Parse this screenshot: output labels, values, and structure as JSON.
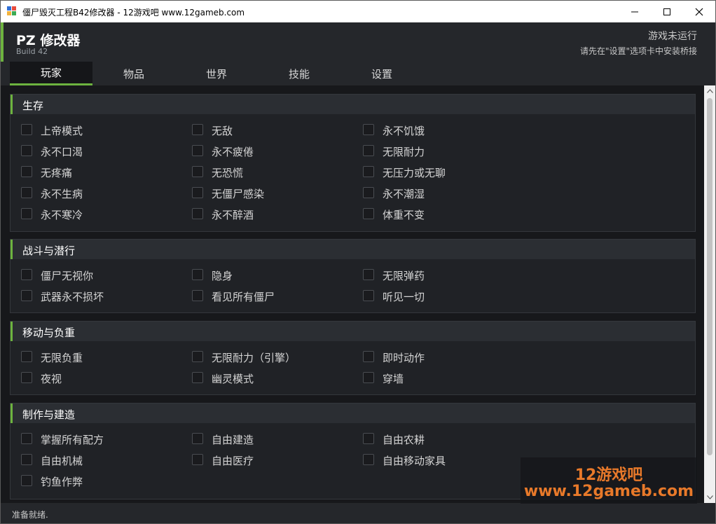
{
  "window": {
    "title": "僵尸毁灭工程B42修改器 - 12游戏吧 www.12gameb.com",
    "app_icon": "app-window-icon",
    "controls": [
      "minimize-icon",
      "maximize-icon",
      "close-icon"
    ]
  },
  "header": {
    "title": "PZ 修改器",
    "build": "Build 42",
    "status_main": "游戏未运行",
    "status_sub": "请先在\"设置\"选项卡中安装桥接"
  },
  "colors": {
    "accent": "#6db33f",
    "background": "#202226",
    "watermark": "#e8792a"
  },
  "tabs": [
    {
      "label": "玩家",
      "active": true
    },
    {
      "label": "物品",
      "active": false
    },
    {
      "label": "世界",
      "active": false
    },
    {
      "label": "技能",
      "active": false
    },
    {
      "label": "设置",
      "active": false
    }
  ],
  "sections": [
    {
      "title": "生存",
      "options": [
        {
          "label": "上帝模式",
          "checked": false
        },
        {
          "label": "无敌",
          "checked": false
        },
        {
          "label": "永不饥饿",
          "checked": false
        },
        {
          "label": "永不口渴",
          "checked": false
        },
        {
          "label": "永不疲倦",
          "checked": false
        },
        {
          "label": "无限耐力",
          "checked": false
        },
        {
          "label": "无疼痛",
          "checked": false
        },
        {
          "label": "无恐慌",
          "checked": false
        },
        {
          "label": "无压力或无聊",
          "checked": false
        },
        {
          "label": "永不生病",
          "checked": false
        },
        {
          "label": "无僵尸感染",
          "checked": false
        },
        {
          "label": "永不潮湿",
          "checked": false
        },
        {
          "label": "永不寒冷",
          "checked": false
        },
        {
          "label": "永不醉酒",
          "checked": false
        },
        {
          "label": "体重不变",
          "checked": false
        }
      ]
    },
    {
      "title": "战斗与潜行",
      "options": [
        {
          "label": "僵尸无视你",
          "checked": false
        },
        {
          "label": "隐身",
          "checked": false
        },
        {
          "label": "无限弹药",
          "checked": false
        },
        {
          "label": "武器永不损坏",
          "checked": false
        },
        {
          "label": "看见所有僵尸",
          "checked": false
        },
        {
          "label": "听见一切",
          "checked": false
        }
      ]
    },
    {
      "title": "移动与负重",
      "options": [
        {
          "label": "无限负重",
          "checked": false
        },
        {
          "label": "无限耐力（引擎）",
          "checked": false
        },
        {
          "label": "即时动作",
          "checked": false
        },
        {
          "label": "夜视",
          "checked": false
        },
        {
          "label": "幽灵模式",
          "checked": false
        },
        {
          "label": "穿墙",
          "checked": false
        }
      ]
    },
    {
      "title": "制作与建造",
      "options": [
        {
          "label": "掌握所有配方",
          "checked": false
        },
        {
          "label": "自由建造",
          "checked": false
        },
        {
          "label": "自由农耕",
          "checked": false
        },
        {
          "label": "自由机械",
          "checked": false
        },
        {
          "label": "自由医疗",
          "checked": false
        },
        {
          "label": "自由移动家具",
          "checked": false
        },
        {
          "label": "钓鱼作弊",
          "checked": false
        }
      ]
    }
  ],
  "statusbar": {
    "text": "准备就绪."
  },
  "watermark": {
    "line1": "12游戏吧",
    "line2": "www.12gameb.com"
  }
}
